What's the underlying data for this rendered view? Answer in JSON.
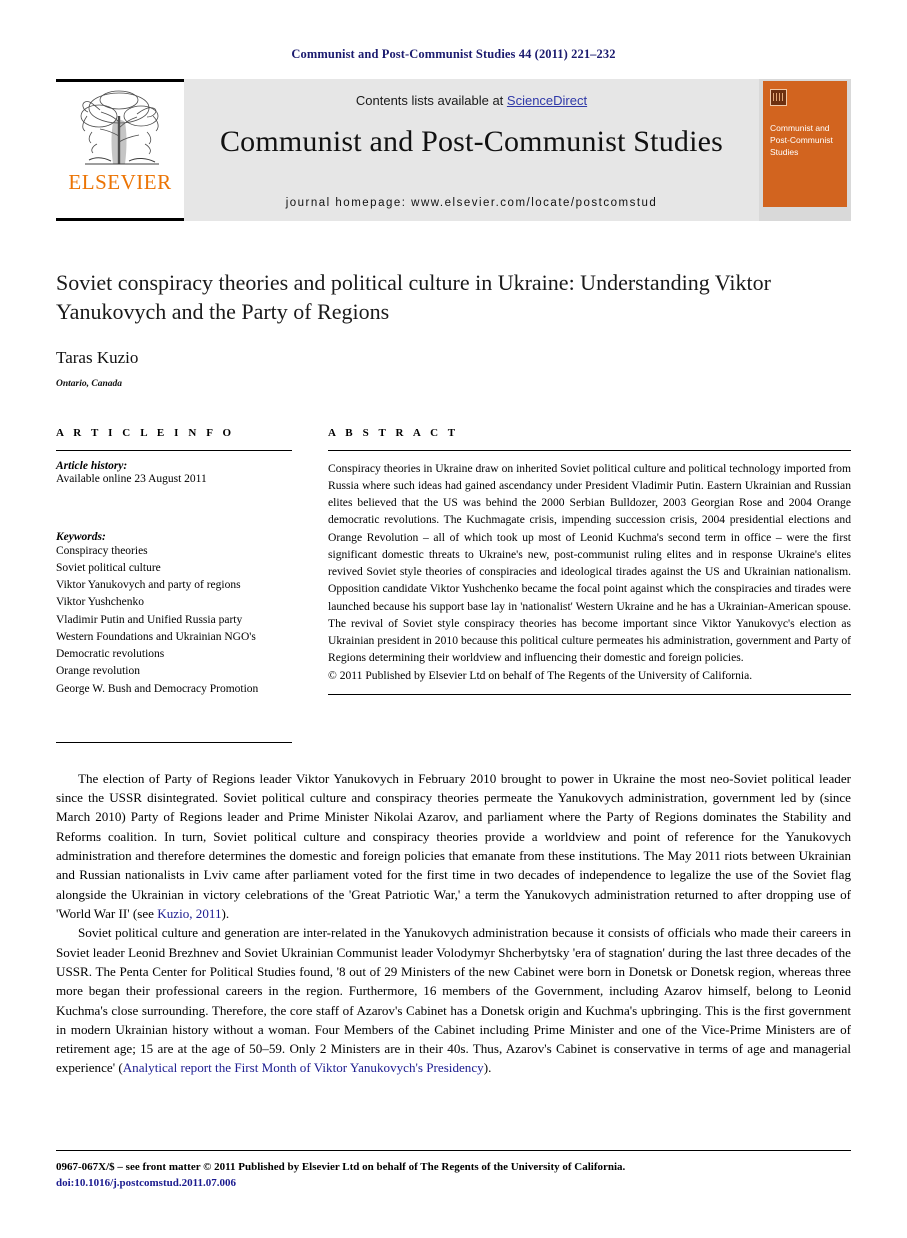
{
  "running_head": "Communist and Post-Communist Studies 44 (2011) 221–232",
  "banner": {
    "contents_prefix": "Contents lists available at ",
    "sciencedirect": "ScienceDirect",
    "journal_title": "Communist and Post-Communist Studies",
    "homepage": "journal homepage: www.elsevier.com/locate/postcomstud",
    "elsevier_wordmark": "ELSEVIER",
    "cover_title": "Communist and Post-Communist Studies",
    "colors": {
      "sciencedirect_blue": "#2f39a8",
      "elsevier_orange": "#ec7404",
      "cover_orange": "#d2641f",
      "banner_gray": "#e6e6e6",
      "running_head_navy": "#1b1b6f"
    }
  },
  "article": {
    "title": "Soviet conspiracy theories and political culture in Ukraine: Understanding Viktor Yanukovych and the Party of Regions",
    "author": "Taras Kuzio",
    "affiliation": "Ontario, Canada"
  },
  "article_info": {
    "section_label": "A R T I C L E   I N F O",
    "history_label": "Article history:",
    "history_value": "Available online 23 August 2011",
    "keywords_label": "Keywords:",
    "keywords": [
      "Conspiracy theories",
      "Soviet political culture",
      "Viktor Yanukovych and party of regions",
      "Viktor Yushchenko",
      "Vladimir Putin and Unified Russia party",
      "Western Foundations and Ukrainian NGO's",
      "Democratic revolutions",
      "Orange revolution",
      "George W. Bush and Democracy Promotion"
    ]
  },
  "abstract": {
    "section_label": "A B S T R A C T",
    "text": "Conspiracy theories in Ukraine draw on inherited Soviet political culture and political technology imported from Russia where such ideas had gained ascendancy under President Vladimir Putin. Eastern Ukrainian and Russian elites believed that the US was behind the 2000 Serbian Bulldozer, 2003 Georgian Rose and 2004 Orange democratic revolutions. The Kuchmagate crisis, impending succession crisis, 2004 presidential elections and Orange Revolution – all of which took up most of Leonid Kuchma's second term in office – were the first significant domestic threats to Ukraine's new, post-communist ruling elites and in response Ukraine's elites revived Soviet style theories of conspiracies and ideological tirades against the US and Ukrainian nationalism. Opposition candidate Viktor Yushchenko became the focal point against which the conspiracies and tirades were launched because his support base lay in 'nationalist' Western Ukraine and he has a Ukrainian-American spouse. The revival of Soviet style conspiracy theories has become important since Viktor Yanukovyc's election as Ukrainian president in 2010 because this political culture permeates his administration, government and Party of Regions determining their worldview and influencing their domestic and foreign policies.",
    "copyright": "© 2011 Published by Elsevier Ltd on behalf of The Regents of the University of California."
  },
  "body": {
    "paragraph_1_part_1": "The election of Party of Regions leader Viktor Yanukovych in February 2010 brought to power in Ukraine the most neo-Soviet political leader since the USSR disintegrated. Soviet political culture and conspiracy theories permeate the Yanukovych administration, government led by (since March 2010) Party of Regions leader and Prime Minister Nikolai Azarov, and parliament where the Party of Regions dominates the Stability and Reforms coalition. In turn, Soviet political culture and conspiracy theories provide a worldview and point of reference for the Yanukovych administration and therefore determines the domestic and foreign policies that emanate from these institutions. The May 2011 riots between Ukrainian and Russian nationalists in Lviv came after parliament voted for the first time in two decades of independence to legalize the use of the Soviet flag alongside the Ukrainian in victory celebrations of the 'Great Patriotic War,' a term the Yanukovych administration returned to after dropping use of 'World War II' (see ",
    "paragraph_1_link": "Kuzio, 2011",
    "paragraph_1_part_2": ").",
    "paragraph_2_part_1": "Soviet political culture and generation are inter-related in the Yanukovych administration because it consists of officials who made their careers in Soviet leader Leonid Brezhnev and Soviet Ukrainian Communist leader Volodymyr Shcherbytsky 'era of stagnation' during the last three decades of the USSR. The Penta Center for Political Studies found, '8 out of 29 Ministers of the new Cabinet were born in Donetsk or Donetsk region, whereas three more began their professional careers in the region. Furthermore, 16 members of the Government, including Azarov himself, belong to Leonid Kuchma's close surrounding. Therefore, the core staff of Azarov's Cabinet has a Donetsk origin and Kuchma's upbringing. This is the first government in modern Ukrainian history without a woman. Four Members of the Cabinet including Prime Minister and one of the Vice-Prime Ministers are of retirement age; 15 are at the age of 50–59. Only 2 Ministers are in their 40s. Thus, Azarov's Cabinet is conservative in terms of age and managerial experience' (",
    "paragraph_2_link": "Analytical report the First Month of Viktor Yanukovych's Presidency",
    "paragraph_2_part_2": ")."
  },
  "footer": {
    "front_matter": "0967-067X/$ – see front matter © 2011 Published by Elsevier Ltd on behalf of The Regents of the University of California.",
    "doi": "doi:10.1016/j.postcomstud.2011.07.006"
  }
}
